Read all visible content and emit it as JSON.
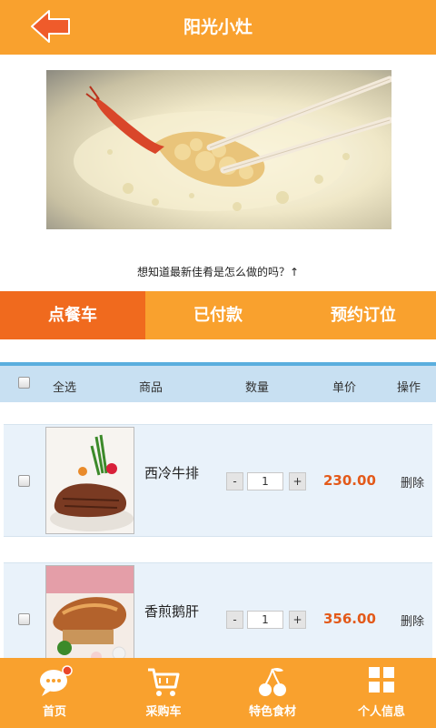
{
  "header": {
    "title": "阳光小灶",
    "back_icon": "back-arrow-icon"
  },
  "banner": {
    "caption": "想知道最新佳肴是怎么做的吗？↑",
    "image": "fried-shrimp-photo"
  },
  "tabs": [
    {
      "label": "点餐车",
      "active": true
    },
    {
      "label": "已付款",
      "active": false
    },
    {
      "label": "预约订位",
      "active": false
    }
  ],
  "table": {
    "columns": {
      "select_all": "全选",
      "item": "商品",
      "quantity": "数量",
      "unit_price": "单价",
      "action": "操作"
    },
    "rows": [
      {
        "name": "西冷牛排",
        "quantity": "1",
        "price": "230.00",
        "delete": "删除",
        "image": "sirloin-steak-photo"
      },
      {
        "name": "香煎鹅肝",
        "quantity": "1",
        "price": "356.00",
        "delete": "删除",
        "image": "foie-gras-photo"
      }
    ],
    "minus": "-",
    "plus": "+"
  },
  "bottom_nav": [
    {
      "label": "首页",
      "icon": "chat-bubble-icon"
    },
    {
      "label": "采购车",
      "icon": "cart-icon"
    },
    {
      "label": "特色食材",
      "icon": "cherry-icon"
    },
    {
      "label": "个人信息",
      "icon": "grid-icon"
    }
  ],
  "colors": {
    "brand_orange": "#f9a12e",
    "active_tab": "#f06a1e",
    "price_red": "#e35a1a",
    "table_blue": "#c8e0f2"
  }
}
